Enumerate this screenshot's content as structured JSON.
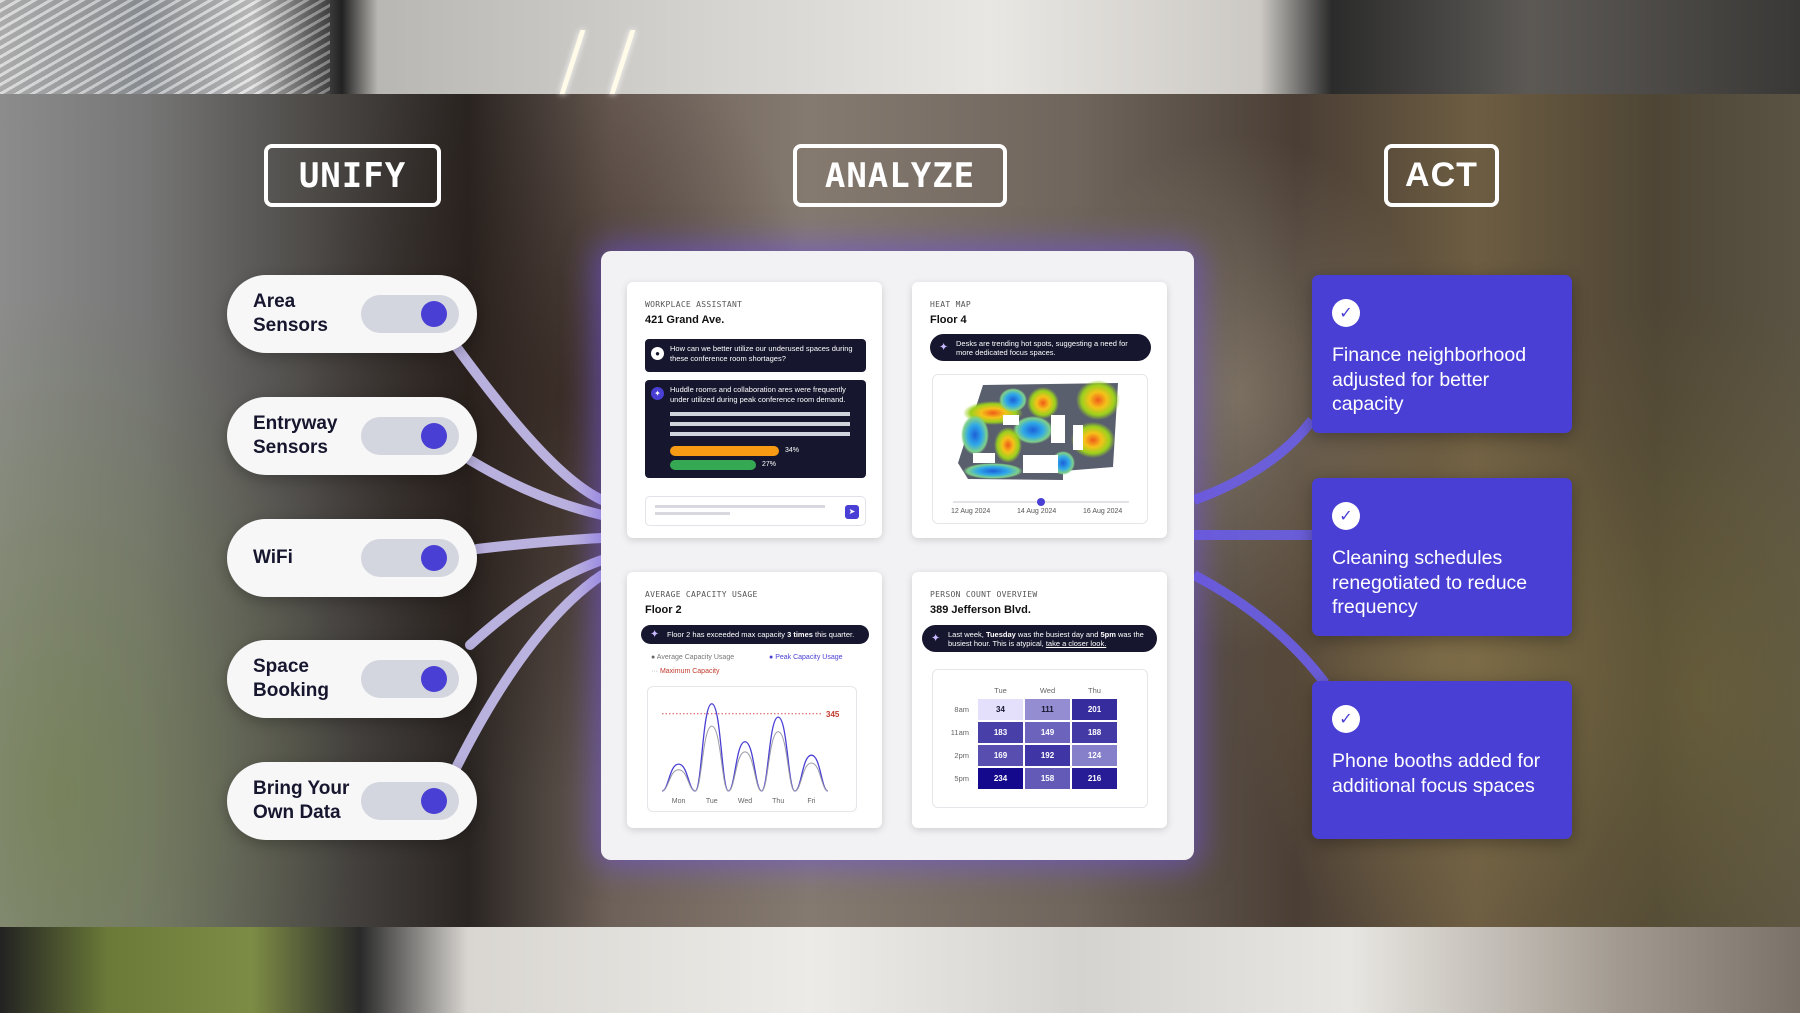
{
  "stages": {
    "unify": "UNIFY",
    "analyze": "ANALYZE",
    "act": "ACT"
  },
  "sources": [
    {
      "label": "Area Sensors",
      "enabled": true
    },
    {
      "label": "Entryway Sensors",
      "enabled": true
    },
    {
      "label": "WiFi",
      "enabled": true
    },
    {
      "label": "Space Booking",
      "enabled": true
    },
    {
      "label": "Bring Your Own Data",
      "enabled": true
    }
  ],
  "analyze": {
    "assistant": {
      "kicker": "WORKPLACE ASSISTANT",
      "title": "421 Grand Ave.",
      "question": "How can we better utilize our underused spaces during these conference room shortages?",
      "answer": "Huddle rooms and collaboration ares were frequently under utilized during peak conference room demand.",
      "bars": [
        {
          "value": "34%",
          "fraction": 0.34,
          "color": "#f79a14"
        },
        {
          "value": "27%",
          "fraction": 0.27,
          "color": "#34a853"
        }
      ]
    },
    "heatmap": {
      "kicker": "HEAT MAP",
      "title": "Floor 4",
      "insight": "Desks are trending hot spots, suggesting a need for more dedicated focus spaces.",
      "dates": [
        "12 Aug 2024",
        "14 Aug 2024",
        "16 Aug 2024"
      ],
      "selected_date": "14 Aug 2024"
    },
    "capacity": {
      "kicker": "AVERAGE CAPACITY USAGE",
      "title": "Floor 2",
      "insight_pre": "Floor 2 has exceeded max capacity ",
      "insight_bold": "3 times",
      "insight_post": " this quarter.",
      "legend": {
        "avg": "Average Capacity Usage",
        "peak": "Peak Capacity Usage",
        "max": "Maximum Capacity"
      },
      "max_value": "345"
    },
    "person_count": {
      "kicker": "PERSON COUNT OVERVIEW",
      "title": "389 Jefferson Blvd.",
      "insight_1": "Last week, ",
      "insight_day": "Tuesday",
      "insight_2": " was the busiest day and ",
      "insight_hour": "5pm",
      "insight_3": " was the busiest hour. This is atypical, ",
      "insight_link": "take a closer look.",
      "columns": [
        "Tue",
        "Wed",
        "Thu"
      ],
      "rows": [
        {
          "label": "8am",
          "values": [
            "34",
            "111",
            "201"
          ]
        },
        {
          "label": "11am",
          "values": [
            "183",
            "149",
            "188"
          ]
        },
        {
          "label": "2pm",
          "values": [
            "169",
            "192",
            "124"
          ]
        },
        {
          "label": "5pm",
          "values": [
            "234",
            "158",
            "216"
          ]
        }
      ]
    }
  },
  "chart_data": {
    "type": "line",
    "title": "Average Capacity Usage - Floor 2",
    "categories": [
      "Mon",
      "Tue",
      "Wed",
      "Thu",
      "Fri"
    ],
    "series": [
      {
        "name": "Peak Capacity Usage",
        "values": [
          120,
          390,
          220,
          330,
          160
        ]
      },
      {
        "name": "Average Capacity Usage",
        "values": [
          95,
          290,
          175,
          265,
          125
        ]
      }
    ],
    "reference_line": {
      "name": "Maximum Capacity",
      "value": 345
    },
    "ylim": [
      0,
      420
    ]
  },
  "actions": [
    {
      "text": "Finance neighborhood adjusted for better capacity"
    },
    {
      "text": "Cleaning schedules renegotiated to reduce frequency"
    },
    {
      "text": "Phone booths added for additional focus spaces"
    }
  ],
  "colors": {
    "accent": "#4a3fd4",
    "dark": "#16162e",
    "max_line": "#c0392b"
  }
}
